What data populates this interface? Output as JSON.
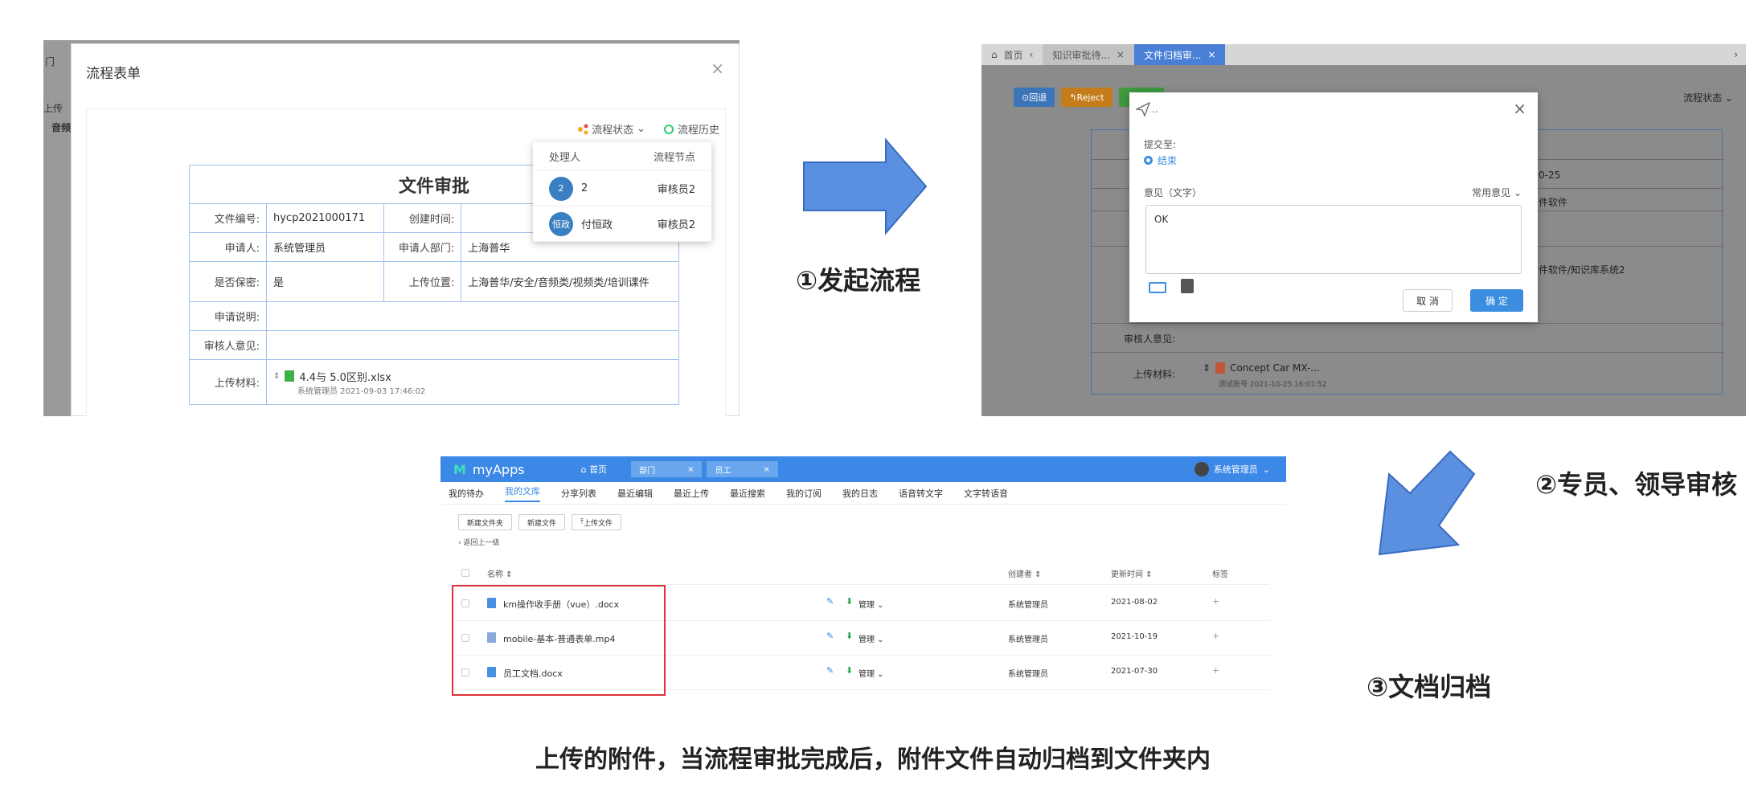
{
  "panel1": {
    "bg": {
      "t1": "门",
      "t2": "上传",
      "t3": "音频"
    },
    "title": "流程表单",
    "close": "×",
    "toolbar": {
      "status": "流程状态",
      "history": "流程历史"
    },
    "form": {
      "title": "文件审批",
      "file_no_label": "文件编号:",
      "file_no": "hycp2021000171",
      "created_label": "创建时间:",
      "applicant_label": "申请人:",
      "applicant": "系统管理员",
      "dept_label": "申请人部门:",
      "dept": "上海普华",
      "secret_label": "是否保密:",
      "secret": "是",
      "location_label": "上传位置:",
      "location": "上海普华/安全/音频类/视频类/培训课件",
      "desc_label": "申请说明:",
      "opinion_label": "审核人意见:",
      "material_label": "上传材料:",
      "file_name": "4.4与 5.0区别.xlsx",
      "file_meta": "系统管理员  2021-09-03 17:46:02"
    },
    "popover": {
      "head_handler": "处理人",
      "head_node": "流程节点",
      "rows": [
        {
          "avatar": "2",
          "name": "2",
          "node": "审核员2"
        },
        {
          "avatar": "恒政",
          "name": "付恒政",
          "node": "审核员2"
        }
      ]
    }
  },
  "caption1": "①发起流程",
  "panel2": {
    "tabs": {
      "home": "首页",
      "t1": "知识审批待...",
      "t2": "文件归档审..."
    },
    "buttons": {
      "back": "回退",
      "reject": "Reject"
    },
    "status": "流程状态",
    "bg_rows": {
      "date": "0-25",
      "soft": "件软件",
      "path": "件软件/知识库系统2",
      "opinion_label": "审核人意见:",
      "material_label": "上传材料:",
      "file": "Concept Car MX-...",
      "file_meta": "测试账号  2021-10-25 16:01:52"
    },
    "dialog": {
      "title": "..",
      "submit_to_label": "提交至:",
      "option": "结束",
      "opinion_label": "意见（文字）",
      "common": "常用意见",
      "text": "OK",
      "cancel": "取 消",
      "ok": "确 定"
    }
  },
  "caption2": "②专员、领导审核",
  "caption3": "③文档归档",
  "panel3": {
    "brand": "myApps",
    "home": "首页",
    "tabs": [
      "部门",
      "员工"
    ],
    "user": "系统管理员",
    "nav": [
      "我的待办",
      "我的文库",
      "分享列表",
      "最近编辑",
      "最近上传",
      "最近搜索",
      "我的订阅",
      "我的日志",
      "语音转文字",
      "文字转语音"
    ],
    "actions": [
      "新建文件夹",
      "新建文件",
      "上传文件"
    ],
    "back": "返回上一级",
    "headers": {
      "name": "名称",
      "creator": "创建者",
      "updated": "更新时间",
      "tag": "标签"
    },
    "manage": "管理",
    "rows": [
      {
        "name": "km操作收手册（vue）.docx",
        "creator": "系统管理员",
        "date": "2021-08-02"
      },
      {
        "name": "mobile-基本-普通表单.mp4",
        "creator": "系统管理员",
        "date": "2021-10-19"
      },
      {
        "name": "员工文档.docx",
        "creator": "系统管理员",
        "date": "2021-07-30"
      }
    ]
  },
  "footer": "上传的附件，当流程审批完成后，附件文件自动归档到文件夹内",
  "colors": {
    "arrow": "#5b8fe0",
    "accent": "#3b88e6",
    "highlight": "#e2333b"
  }
}
